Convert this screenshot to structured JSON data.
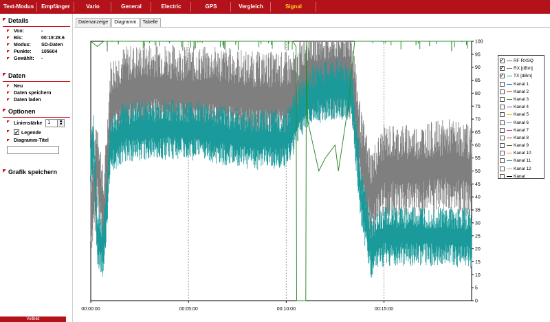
{
  "nav": {
    "tabs": [
      {
        "label": "Text-Modus",
        "active": false
      },
      {
        "label": "Empfänger",
        "active": false
      },
      {
        "label": "Vario",
        "active": false
      },
      {
        "label": "General",
        "active": false
      },
      {
        "label": "Electric",
        "active": false
      },
      {
        "label": "GPS",
        "active": false
      },
      {
        "label": "Vergleich",
        "active": false
      },
      {
        "label": "Signal",
        "active": true
      }
    ]
  },
  "details": {
    "title": "Details",
    "rows": [
      {
        "key": "Von:",
        "value": "-"
      },
      {
        "key": "Bis:",
        "value": "00:19:28.6"
      },
      {
        "key": "Modus:",
        "value": "SD-Daten"
      },
      {
        "key": "Punkte:",
        "value": "105604"
      },
      {
        "key": "Gewählt:",
        "value": "-"
      }
    ]
  },
  "daten": {
    "title": "Daten",
    "items": [
      "Neu",
      "Daten speichern",
      "Daten laden"
    ]
  },
  "optionen": {
    "title": "Optionen",
    "linienstaerke_label": "Linienstärke",
    "linienstaerke_value": "1",
    "legende_label": "Legende",
    "legende_checked": true,
    "diagramm_titel_label": "Diagramm-Titel",
    "diagramm_titel_value": ""
  },
  "grafik": {
    "title": "Grafik speichern"
  },
  "footer": {
    "vollbild": "Vollbild"
  },
  "subtabs": [
    {
      "label": "Datenanzeige",
      "active": false
    },
    {
      "label": "Diagramm",
      "active": true
    },
    {
      "label": "Tabelle",
      "active": false
    }
  ],
  "legend": [
    {
      "label": "RF RXSQ",
      "checked": true,
      "color": "#2e8b2e"
    },
    {
      "label": "RX [dBm]",
      "checked": true,
      "color": "#7f7f7f"
    },
    {
      "label": "TX [dBm]",
      "checked": true,
      "color": "#1a9a9a"
    },
    {
      "label": "Kanal 1",
      "checked": false,
      "color": "#1f4fcf"
    },
    {
      "label": "Kanal 2",
      "checked": false,
      "color": "#c02020"
    },
    {
      "label": "Kanal 3",
      "checked": false,
      "color": "#2e8b2e"
    },
    {
      "label": "Kanal 4",
      "checked": false,
      "color": "#8a2be2"
    },
    {
      "label": "Kanal 5",
      "checked": false,
      "color": "#e0d020"
    },
    {
      "label": "Kanal 6",
      "checked": false,
      "color": "#20b0b0"
    },
    {
      "label": "Kanal 7",
      "checked": false,
      "color": "#d02090"
    },
    {
      "label": "Kanal 8",
      "checked": false,
      "color": "#8b4513"
    },
    {
      "label": "Kanal 9",
      "checked": false,
      "color": "#556b2f"
    },
    {
      "label": "Kanal 10",
      "checked": false,
      "color": "#ff8c00"
    },
    {
      "label": "Kanal 11",
      "checked": false,
      "color": "#4682b4"
    },
    {
      "label": "Kanal 12",
      "checked": false,
      "color": "#a0a0a0"
    },
    {
      "label": "Kanal",
      "checked": false,
      "color": "#000000"
    }
  ],
  "chart_data": {
    "type": "line",
    "x_tick_labels": [
      "00:00:00",
      "00:05:00",
      "00:10:00",
      "00:15:00"
    ],
    "x_ticks_seconds": [
      0,
      300,
      600,
      900
    ],
    "xlim_seconds": [
      0,
      1169
    ],
    "y_tick_labels": [
      "0",
      "5",
      "10",
      "15",
      "20",
      "25",
      "30",
      "35",
      "40",
      "45",
      "50",
      "55",
      "60",
      "65",
      "70",
      "75",
      "80",
      "85",
      "90",
      "95",
      "100"
    ],
    "ylim": [
      0,
      100
    ],
    "grid": "vertical dotted at x ticks",
    "series": [
      {
        "name": "RF RXSQ",
        "color": "#2e8b2e",
        "x": [
          0,
          20,
          40,
          80,
          150,
          250,
          350,
          450,
          550,
          620,
          630,
          632,
          660,
          662,
          665,
          700,
          720,
          750,
          760,
          790,
          810,
          880,
          1000,
          1100,
          1169
        ],
        "y": [
          100,
          98,
          100,
          100,
          100,
          100,
          100,
          100,
          100,
          100,
          98,
          0,
          0,
          100,
          70,
          50,
          55,
          60,
          50,
          75,
          100,
          100,
          100,
          100,
          100
        ]
      },
      {
        "name": "RX [dBm]",
        "color": "#7f7f7f",
        "x": [
          0,
          10,
          20,
          40,
          60,
          100,
          200,
          300,
          400,
          500,
          600,
          630,
          660,
          700,
          760,
          800,
          830,
          860,
          900,
          1000,
          1100,
          1169
        ],
        "y": [
          35,
          40,
          55,
          30,
          75,
          80,
          82,
          80,
          80,
          78,
          78,
          78,
          88,
          88,
          88,
          88,
          55,
          40,
          50,
          50,
          52,
          50
        ]
      },
      {
        "name": "TX [dBm]",
        "color": "#1a9a9a",
        "x": [
          0,
          10,
          20,
          40,
          60,
          100,
          200,
          300,
          400,
          500,
          600,
          630,
          660,
          700,
          760,
          800,
          830,
          860,
          900,
          1000,
          1100,
          1169
        ],
        "y": [
          55,
          60,
          25,
          20,
          60,
          65,
          66,
          66,
          64,
          62,
          62,
          70,
          78,
          80,
          82,
          80,
          40,
          20,
          25,
          25,
          25,
          24
        ]
      }
    ]
  }
}
